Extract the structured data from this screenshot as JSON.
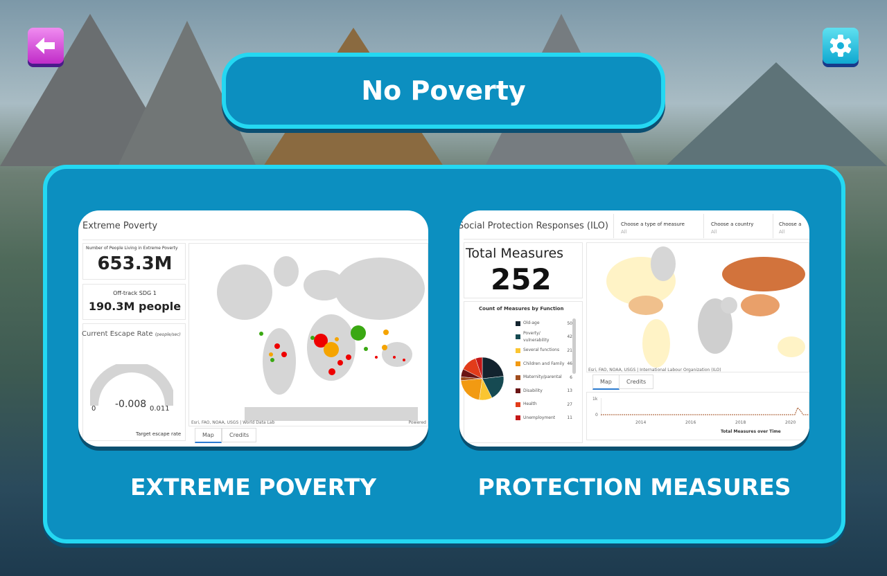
{
  "header": {
    "title": "No Poverty",
    "back_icon": "arrow-left-icon",
    "settings_icon": "gear-icon"
  },
  "cards": [
    {
      "label": "EXTREME POVERTY",
      "dashboard": {
        "title": "Extreme Poverty",
        "metric1_label": "Number of People Living in Extreme Poverty",
        "metric1_value": "653.3M",
        "metric2_label": "Off-track SDG 1",
        "metric2_value": "190.3M people",
        "gauge_title": "Current Escape Rate",
        "gauge_unit": "(people/sec)",
        "gauge_value": "-0.008",
        "gauge_min": "0",
        "gauge_max": "0.011",
        "gauge_footer": "Target escape rate",
        "map_attribution": "Esri, FAO, NOAA, USGS | World Data Lab",
        "powered": "Powered",
        "tabs": [
          "Map",
          "Credits"
        ]
      }
    },
    {
      "label": "PROTECTION MEASURES",
      "dashboard": {
        "title": "Social Protection Responses (ILO)",
        "filters": [
          {
            "label": "Choose a type of measure",
            "value": "All"
          },
          {
            "label": "Choose a country",
            "value": "All"
          },
          {
            "label": "Choose a",
            "value": "All"
          }
        ],
        "total_label": "Total Measures",
        "total_value": "252",
        "pie_title": "Count of Measures by Function",
        "legend": [
          {
            "name": "Old-age",
            "value": "50",
            "color": "#13232e"
          },
          {
            "name": "Poverty/ vulnerability",
            "value": "42",
            "color": "#164a52"
          },
          {
            "name": "Several functions",
            "value": "21",
            "color": "#fbc531"
          },
          {
            "name": "Children and Family",
            "value": "46",
            "color": "#f29a12"
          },
          {
            "name": "Maternity/parental",
            "value": "6",
            "color": "#a04d1e"
          },
          {
            "name": "Disability",
            "value": "13",
            "color": "#6a1414"
          },
          {
            "name": "Health",
            "value": "27",
            "color": "#e23c1a"
          },
          {
            "name": "Unemployment",
            "value": "11",
            "color": "#c41818"
          }
        ],
        "map_attribution": "Esri, FAO, NOAA, USGS | International Labour Organization (ILO)",
        "tabs": [
          "Map",
          "Credits"
        ],
        "chart_title": "Total Measures over Time",
        "y_ticks": [
          "1k",
          "0"
        ],
        "x_ticks": [
          "2014",
          "2016",
          "2018",
          "2020"
        ]
      }
    }
  ]
}
